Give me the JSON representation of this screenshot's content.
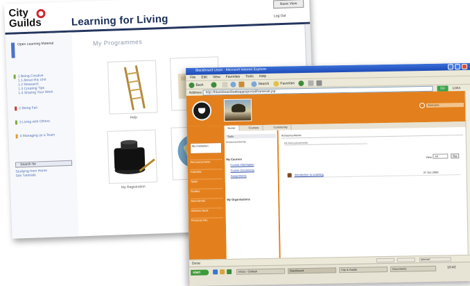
{
  "back_window": {
    "logo_line1": "City",
    "logo_line2": "Guilds",
    "title": "Learning for Living",
    "basic_view_label": "Basic View",
    "logout_label": "Log Out",
    "left_heading": "Open Learning Material",
    "nav": [
      "1 Being Creative",
      "1.1 About this Unit",
      "1.2 Research",
      "1.3 Creating Tips",
      "1.4 Sharing Your Work",
      "2 Being Fair",
      "3 Living with Others",
      "4 Managing as a Team"
    ],
    "search_label": "Search for",
    "extra_links": [
      "Studying from Home",
      "Site Tutorials"
    ],
    "programmes_title": "My Programmes",
    "tile_captions": [
      "Help",
      "My Registration"
    ],
    "colors": {
      "title_blue": "#1a2d58",
      "logo_ring": "#d0252f",
      "nav_bar": "#7aaa3c"
    }
  },
  "front_window": {
    "title": "Blackboard Learn - Microsoft Internet Explorer",
    "menu": [
      "File",
      "Edit",
      "View",
      "Favorites",
      "Tools",
      "Help"
    ],
    "toolbar": {
      "back": "Back",
      "search": "Search",
      "favorites": "Favorites"
    },
    "address_label": "Address",
    "address_value": "http://blackboard/webapps/portal/frameset.jsp",
    "go_label": "Go",
    "links_label": "Links",
    "user_box": "Welcome",
    "tabs": [
      "Home",
      "Courses",
      "Community"
    ],
    "sidebar_box": "My Institution",
    "sidebar_items": [
      "Announcements",
      "Calendar",
      "Tasks",
      "Grades",
      "Send Email",
      "Address Book",
      "Personal Info"
    ],
    "tools_head": "Tools",
    "tools_small": "Announcements",
    "my_courses_label": "My Courses",
    "course_links": [
      "Course Information",
      "Course Documents",
      "Assignments"
    ],
    "organisations_label": "My Organisations",
    "main_head": "Announcements",
    "main_sub": "All Announcements",
    "view_label": "View",
    "view_value": "All",
    "view_go": "Go",
    "row_link": "Introduction to Learning",
    "row_meta": "27 Oct 2009",
    "status_text": "Done",
    "status_zone": "Internet",
    "start_label": "start",
    "task_items": [
      "Inbox - Outlook",
      "Blackboard",
      "City & Guilds",
      "Document1"
    ],
    "clock": "10:42",
    "colors": {
      "orange": "#e3801d",
      "xp_blue": "#1d4bb7",
      "link_blue": "#2948a8"
    }
  }
}
